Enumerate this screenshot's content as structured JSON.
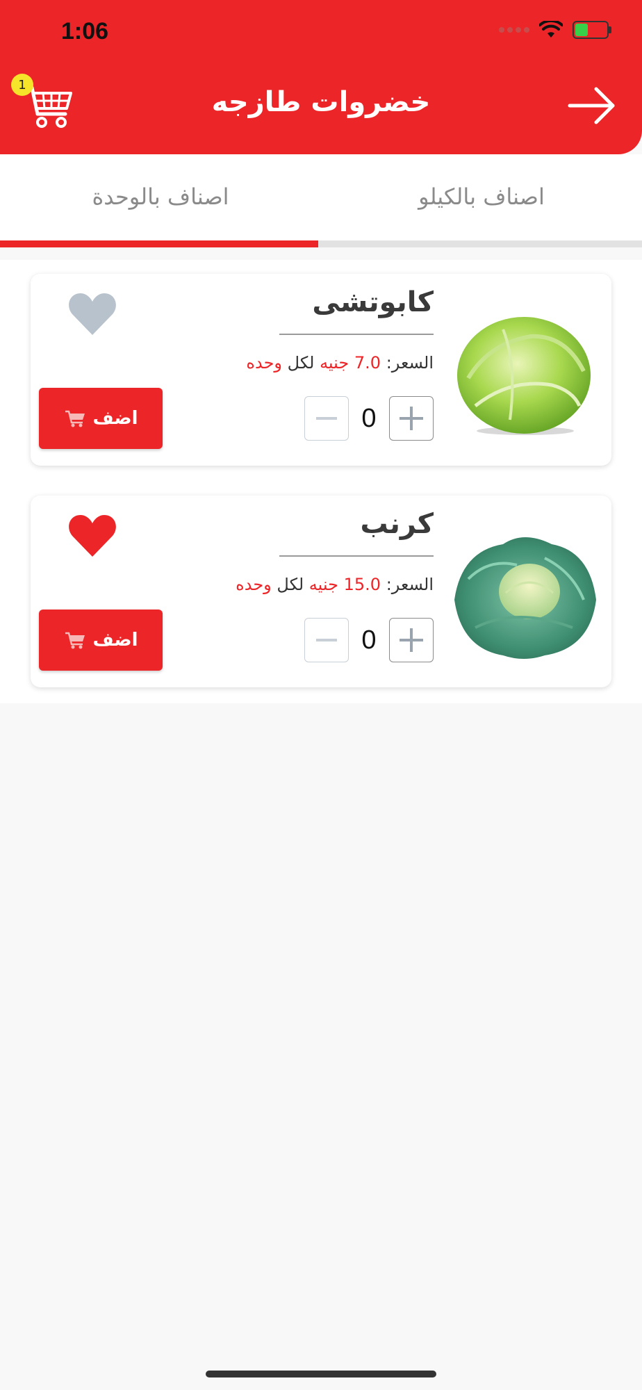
{
  "status_bar": {
    "time": "1:06"
  },
  "header": {
    "title": "خضروات طازجه",
    "cart_count": "1"
  },
  "tabs": [
    {
      "label": "اصناف بالكيلو",
      "selected": false
    },
    {
      "label": "اصناف بالوحدة",
      "selected": true
    }
  ],
  "products": [
    {
      "name": "كابوتشى",
      "price_label": "السعر:",
      "price_value": "7.0",
      "currency": "جنيه",
      "per": "لكل",
      "unit": "وحده",
      "quantity": "0",
      "favorite": false,
      "add_label": "اضف",
      "image": "iceberg-lettuce"
    },
    {
      "name": "كرنب",
      "price_label": "السعر:",
      "price_value": "15.0",
      "currency": "جنيه",
      "per": "لكل",
      "unit": "وحده",
      "quantity": "0",
      "favorite": true,
      "add_label": "اضف",
      "image": "cabbage"
    }
  ],
  "colors": {
    "brand": "#ec2628",
    "heart_inactive": "#b8c2cc",
    "badge": "#f5e42a"
  },
  "icons": [
    "wifi-icon",
    "battery-icon",
    "cart-icon",
    "arrow-right-icon",
    "heart-icon",
    "plus-icon",
    "minus-icon"
  ]
}
